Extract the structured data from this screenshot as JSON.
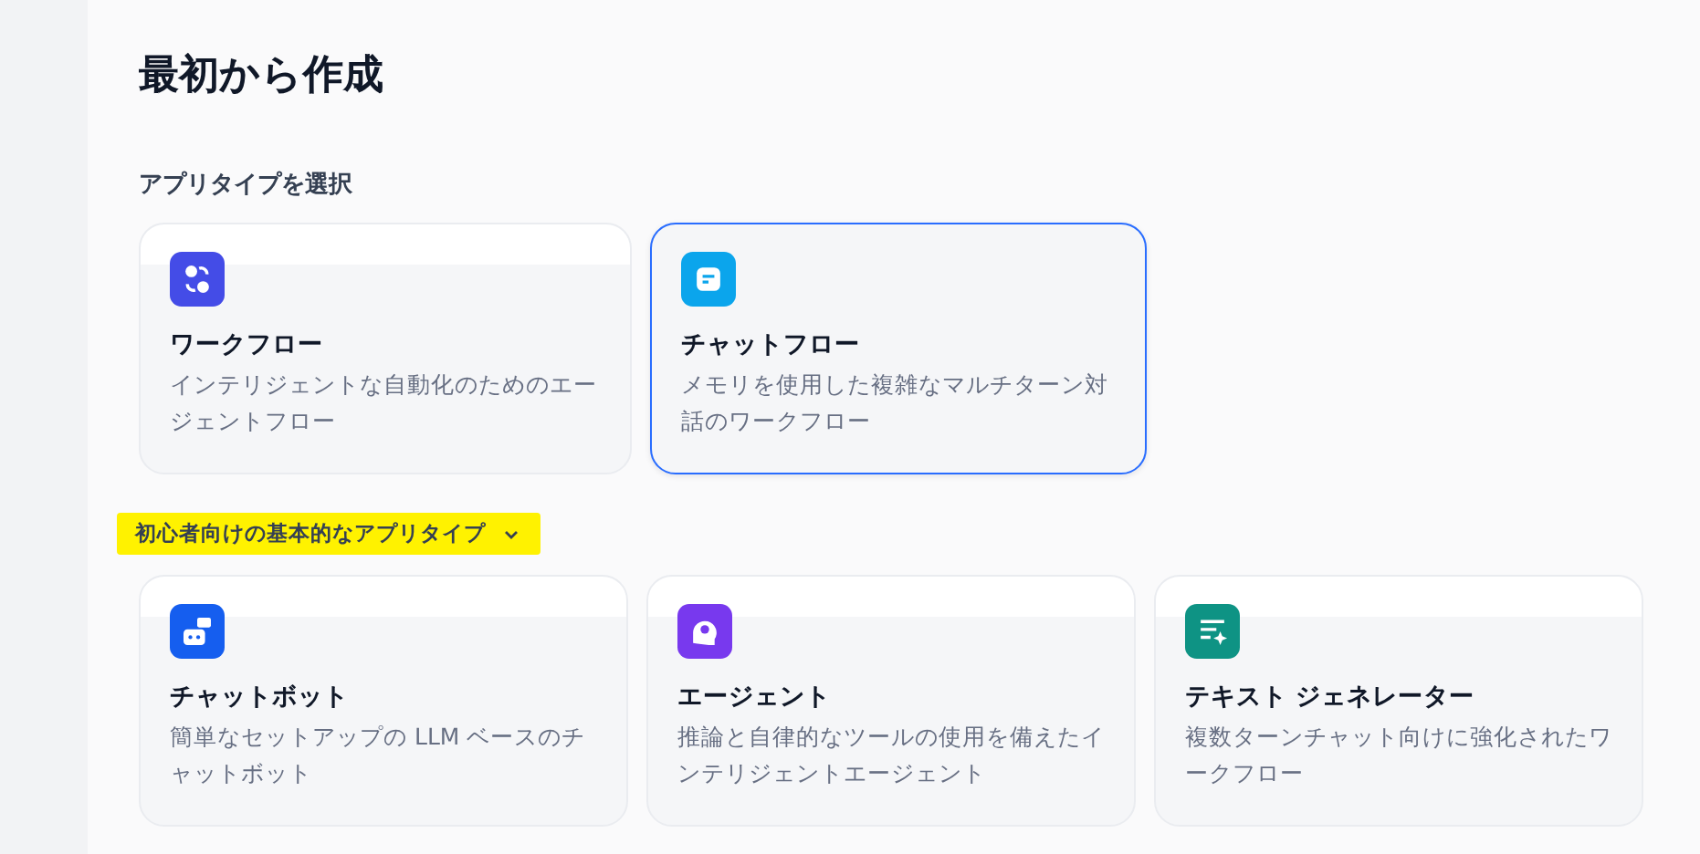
{
  "title": "最初から作成",
  "app_type_section": {
    "label": "アプリタイプを選択",
    "cards": [
      {
        "kind": "workflow",
        "color": "#444ce7",
        "title": "ワークフロー",
        "description": "インテリジェントな自動化のためのエージェントフロー",
        "selected": false
      },
      {
        "kind": "chatflow",
        "color": "#0ba5ec",
        "title": "チャットフロー",
        "description": "メモリを使用した複雑なマルチターン対話のワークフロー",
        "selected": true
      }
    ]
  },
  "beginner_section": {
    "label": "初心者向けの基本的なアプリタイプ",
    "expanded": true,
    "cards": [
      {
        "kind": "chatbot",
        "color": "#155eef",
        "title": "チャットボット",
        "description": "簡単なセットアップの LLM ベースのチャットボット",
        "selected": false
      },
      {
        "kind": "agent",
        "color": "#7839ee",
        "title": "エージェント",
        "description": "推論と自律的なツールの使用を備えたインテリジェントエージェント",
        "selected": false
      },
      {
        "kind": "text-generator",
        "color": "#0e9384",
        "title": "テキスト ジェネレーター",
        "description": "複数ターンチャット向けに強化されたワークフロー",
        "selected": false
      }
    ]
  }
}
